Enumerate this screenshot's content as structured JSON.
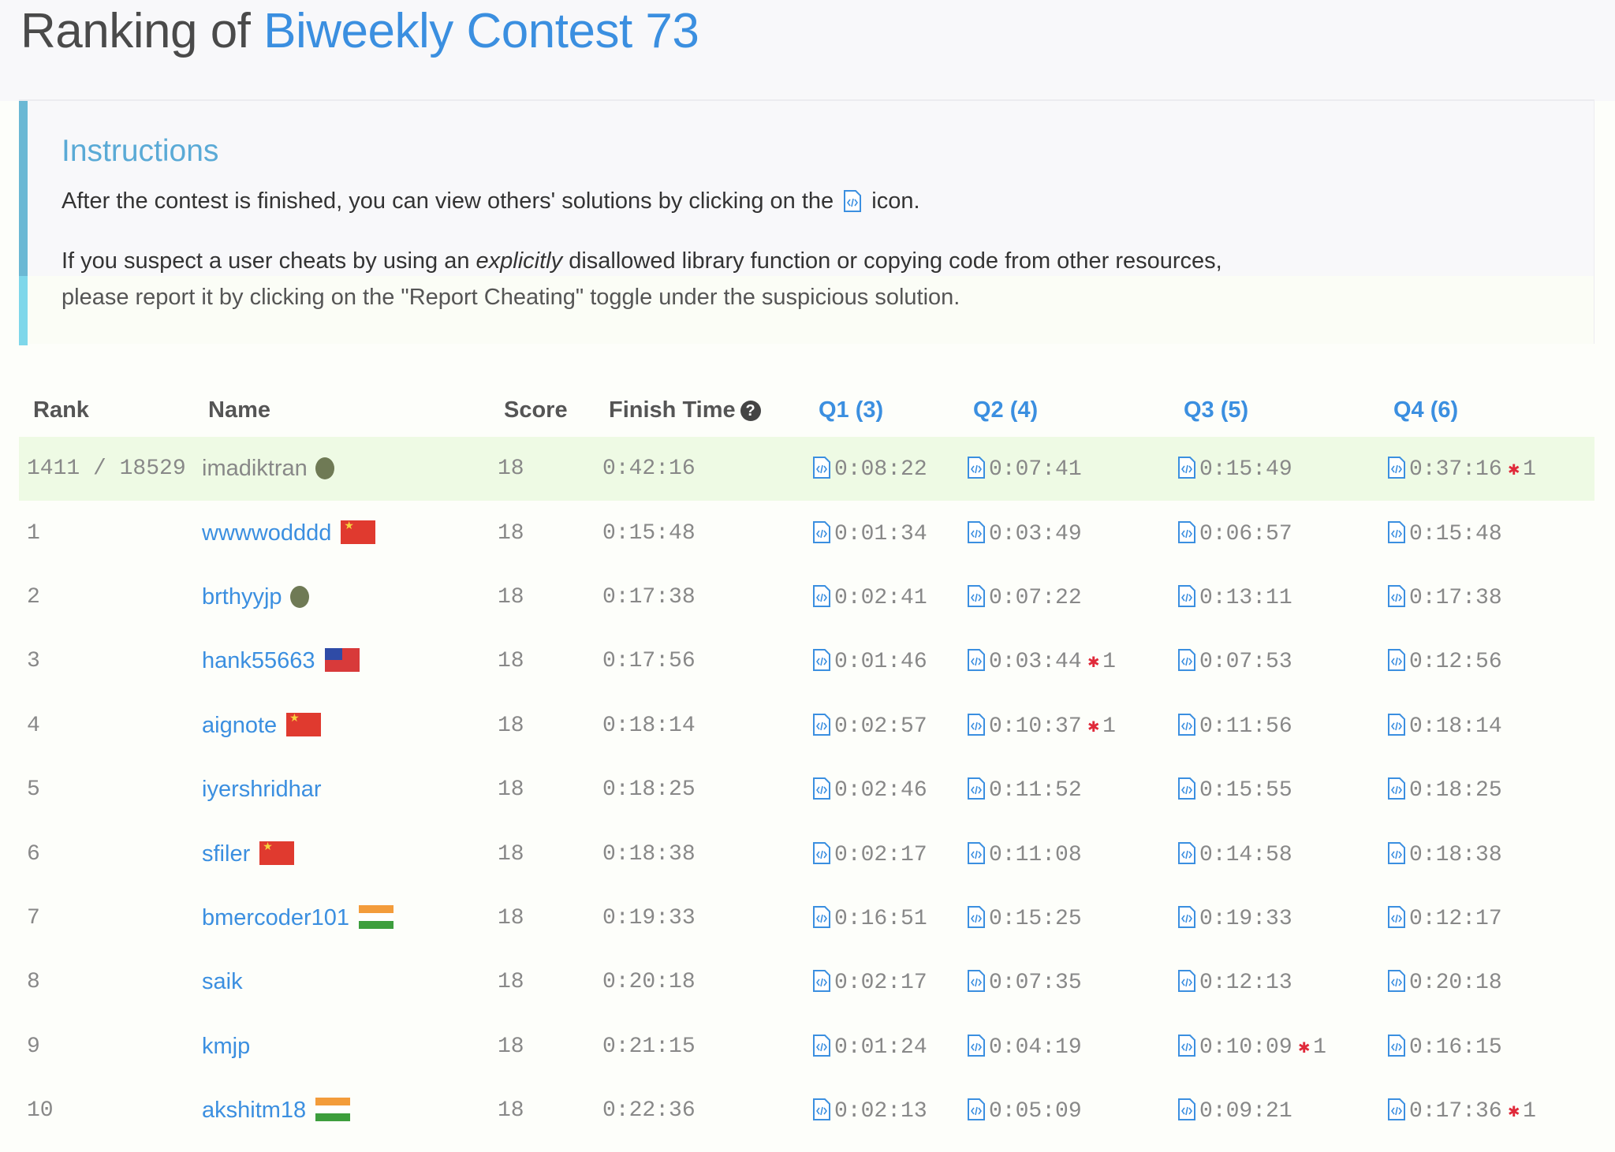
{
  "page": {
    "title_prefix": "Ranking of",
    "contest_name": "Biweekly Contest 73"
  },
  "instructions": {
    "heading": "Instructions",
    "line1_before": "After the contest is finished, you can view others' solutions by clicking on the",
    "line1_after": "icon.",
    "line2_before": "If you suspect a user cheats by using an",
    "line2_em": "explicitly",
    "line2_after": "disallowed library function or copying code from other resources,",
    "line3": "please report it by clicking on the \"Report Cheating\" toggle under the suspicious solution."
  },
  "table": {
    "headers": {
      "rank": "Rank",
      "name": "Name",
      "score": "Score",
      "finish_time": "Finish Time",
      "help_icon": "?",
      "q1": "Q1 (3)",
      "q2": "Q2 (4)",
      "q3": "Q3 (5)",
      "q4": "Q4 (6)"
    },
    "rows": [
      {
        "rank": "1411 / 18529",
        "name": "imadiktran",
        "flag": "badge",
        "score": "18",
        "finish": "0:42:16",
        "q1": "0:08:22",
        "q1_bug": "",
        "q2": "0:07:41",
        "q2_bug": "",
        "q3": "0:15:49",
        "q3_bug": "",
        "q4": "0:37:16",
        "q4_bug": "1",
        "me": true
      },
      {
        "rank": "1",
        "name": "wwwwodddd",
        "flag": "cn",
        "score": "18",
        "finish": "0:15:48",
        "q1": "0:01:34",
        "q1_bug": "",
        "q2": "0:03:49",
        "q2_bug": "",
        "q3": "0:06:57",
        "q3_bug": "",
        "q4": "0:15:48",
        "q4_bug": ""
      },
      {
        "rank": "2",
        "name": "brthyyjp",
        "flag": "badge",
        "score": "18",
        "finish": "0:17:38",
        "q1": "0:02:41",
        "q1_bug": "",
        "q2": "0:07:22",
        "q2_bug": "",
        "q3": "0:13:11",
        "q3_bug": "",
        "q4": "0:17:38",
        "q4_bug": ""
      },
      {
        "rank": "3",
        "name": "hank55663",
        "flag": "tw",
        "score": "18",
        "finish": "0:17:56",
        "q1": "0:01:46",
        "q1_bug": "",
        "q2": "0:03:44",
        "q2_bug": "1",
        "q3": "0:07:53",
        "q3_bug": "",
        "q4": "0:12:56",
        "q4_bug": ""
      },
      {
        "rank": "4",
        "name": "aignote",
        "flag": "cn",
        "score": "18",
        "finish": "0:18:14",
        "q1": "0:02:57",
        "q1_bug": "",
        "q2": "0:10:37",
        "q2_bug": "1",
        "q3": "0:11:56",
        "q3_bug": "",
        "q4": "0:18:14",
        "q4_bug": ""
      },
      {
        "rank": "5",
        "name": "iyershridhar",
        "flag": "",
        "score": "18",
        "finish": "0:18:25",
        "q1": "0:02:46",
        "q1_bug": "",
        "q2": "0:11:52",
        "q2_bug": "",
        "q3": "0:15:55",
        "q3_bug": "",
        "q4": "0:18:25",
        "q4_bug": ""
      },
      {
        "rank": "6",
        "name": "sfiler",
        "flag": "cn",
        "score": "18",
        "finish": "0:18:38",
        "q1": "0:02:17",
        "q1_bug": "",
        "q2": "0:11:08",
        "q2_bug": "",
        "q3": "0:14:58",
        "q3_bug": "",
        "q4": "0:18:38",
        "q4_bug": ""
      },
      {
        "rank": "7",
        "name": "bmercoder101",
        "flag": "in",
        "score": "18",
        "finish": "0:19:33",
        "q1": "0:16:51",
        "q1_bug": "",
        "q2": "0:15:25",
        "q2_bug": "",
        "q3": "0:19:33",
        "q3_bug": "",
        "q4": "0:12:17",
        "q4_bug": ""
      },
      {
        "rank": "8",
        "name": "saik",
        "flag": "",
        "score": "18",
        "finish": "0:20:18",
        "q1": "0:02:17",
        "q1_bug": "",
        "q2": "0:07:35",
        "q2_bug": "",
        "q3": "0:12:13",
        "q3_bug": "",
        "q4": "0:20:18",
        "q4_bug": ""
      },
      {
        "rank": "9",
        "name": "kmjp",
        "flag": "",
        "score": "18",
        "finish": "0:21:15",
        "q1": "0:01:24",
        "q1_bug": "",
        "q2": "0:04:19",
        "q2_bug": "",
        "q3": "0:10:09",
        "q3_bug": "1",
        "q4": "0:16:15",
        "q4_bug": ""
      },
      {
        "rank": "10",
        "name": "akshitm18",
        "flag": "in",
        "score": "18",
        "finish": "0:22:36",
        "q1": "0:02:13",
        "q1_bug": "",
        "q2": "0:05:09",
        "q2_bug": "",
        "q3": "0:09:21",
        "q3_bug": "",
        "q4": "0:17:36",
        "q4_bug": "1"
      }
    ]
  },
  "colors": {
    "link_blue": "#3b8fe0",
    "instructions_accent": "#6bb8d4",
    "my_row_bg": "#eefae4",
    "bug_red": "#e02a3a"
  }
}
